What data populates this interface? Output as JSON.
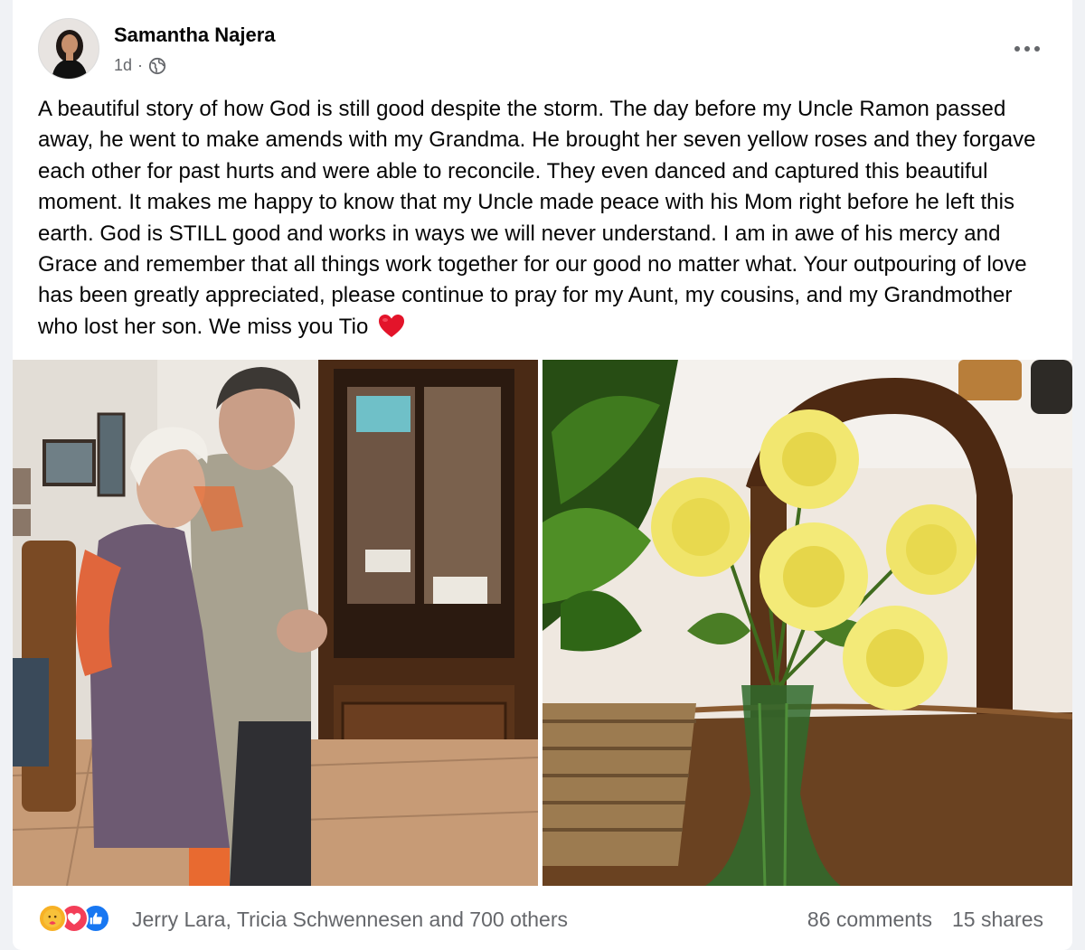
{
  "post": {
    "author": "Samantha Najera",
    "time": "1d",
    "separator": "·",
    "privacy_icon": "globe-icon",
    "more_icon": "more-options-icon",
    "text": "A beautiful story of how God is still good despite the storm. The day before my Uncle Ramon passed away, he went to make amends with my Grandma. He brought her seven yellow roses and they forgave each other for past hurts and were able to reconcile. They even danced and captured this beautiful moment. It makes me happy to know that my Uncle made peace with his Mom right before he left this earth. God is STILL good and works in ways we will never understand. I am in awe of his mercy and Grace and remember that all things work together for our good no matter what. Your outpouring of love has been greatly appreciated, please continue to pray for my Aunt, my cousins, and my Grandmother who lost her son. We miss you Tio",
    "text_emoji": "red-heart-icon"
  },
  "footer": {
    "reactions": [
      "care-icon",
      "love-icon",
      "like-icon"
    ],
    "reaction_names": "Jerry Lara, Tricia Schwennesen and 700 others",
    "comments": "86 comments",
    "shares": "15 shares"
  },
  "colors": {
    "text": "#050505",
    "secondary": "#65676b",
    "like": "#1877f2",
    "love": "#f33e58",
    "care": "#f7b125"
  }
}
